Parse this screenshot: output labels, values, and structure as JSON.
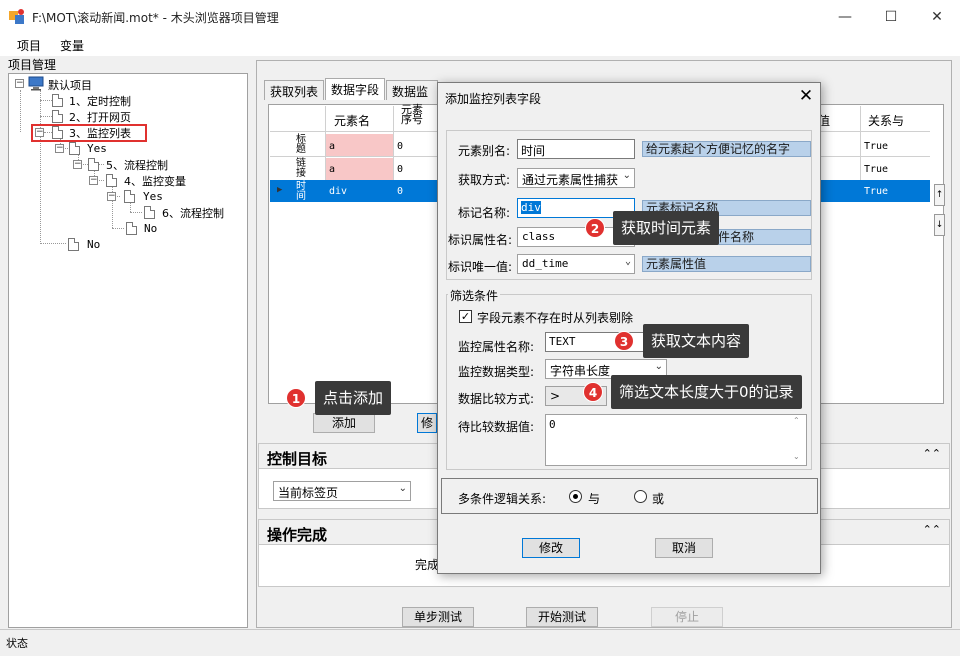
{
  "window": {
    "title": "F:\\MOT\\滚动新闻.mot* - 木头浏览器项目管理",
    "minimize": "—",
    "maximize": "☐",
    "close": "✕"
  },
  "menu": [
    "项目",
    "变量"
  ],
  "project_panel": {
    "label": "项目管理",
    "nodes": [
      "默认项目",
      "1、定时控制",
      "2、打开网页",
      "3、监控列表",
      "Yes",
      "5、流程控制",
      "4、监控变量",
      "Yes",
      "6、流程控制",
      "No",
      "No"
    ]
  },
  "tabs": [
    "获取列表",
    "数据字段",
    "数据监控"
  ],
  "grid": {
    "headers": [
      "元素名",
      "元素序号",
      "值",
      "关系与"
    ],
    "rows": [
      {
        "name": "标题",
        "tag": "a",
        "index": "0",
        "rel": "True"
      },
      {
        "name": "链接",
        "tag": "a",
        "index": "0",
        "rel": "True"
      },
      {
        "name": "时间",
        "tag": "div",
        "index": "0",
        "rel": "True"
      }
    ],
    "row_pointer": "▶",
    "add_button": "添加",
    "partial_button": "修"
  },
  "control_target": {
    "title": "控制目标",
    "select_value": "当前标签页"
  },
  "operation_done": {
    "title": "操作完成",
    "partial_text": "完成"
  },
  "bottom_buttons": {
    "step": "单步测试",
    "start": "开始测试",
    "stop": "停止"
  },
  "status": "状态",
  "dialog": {
    "title": "添加监控列表字段",
    "alias_label": "元素别名:",
    "alias_value": "时间",
    "alias_hint": "给元素起个方便记忆的名字",
    "method_label": "获取方式:",
    "method_value": "通过元素属性捕获",
    "tag_label": "标记名称:",
    "tag_value": "div",
    "tag_hint": "元素标记名称",
    "attr_label": "标识属性名:",
    "attr_value": "class",
    "attr_hint": "元素属性或事件名称",
    "unique_label": "标识唯一值:",
    "unique_value": "dd_time",
    "unique_hint": "元素属性值",
    "filter_title": "筛选条件",
    "filter_checkbox": "字段元素不存在时从列表剔除",
    "monitor_attr_label": "监控属性名称:",
    "monitor_attr_value": "TEXT",
    "monitor_type_label": "监控数据类型:",
    "monitor_type_value": "字符串长度",
    "compare_label": "数据比较方式:",
    "compare_value": ">",
    "target_label": "待比较数据值:",
    "target_value": "0",
    "logic_label": "多条件逻辑关系:",
    "logic_and": "与",
    "logic_or": "或",
    "ok_button": "修改",
    "cancel_button": "取消",
    "close": "✕"
  },
  "callouts": [
    {
      "num": "1",
      "text": "点击添加"
    },
    {
      "num": "2",
      "text": "获取时间元素"
    },
    {
      "num": "3",
      "text": "获取文本内容"
    },
    {
      "num": "4",
      "text": "筛选文本长度大于0的记录"
    }
  ],
  "colors": {
    "highlight_red": "#e0312f",
    "selection_blue": "#0078d7",
    "hint_blue": "#b9d1ea",
    "pink_cell": "#f8c7c7"
  }
}
